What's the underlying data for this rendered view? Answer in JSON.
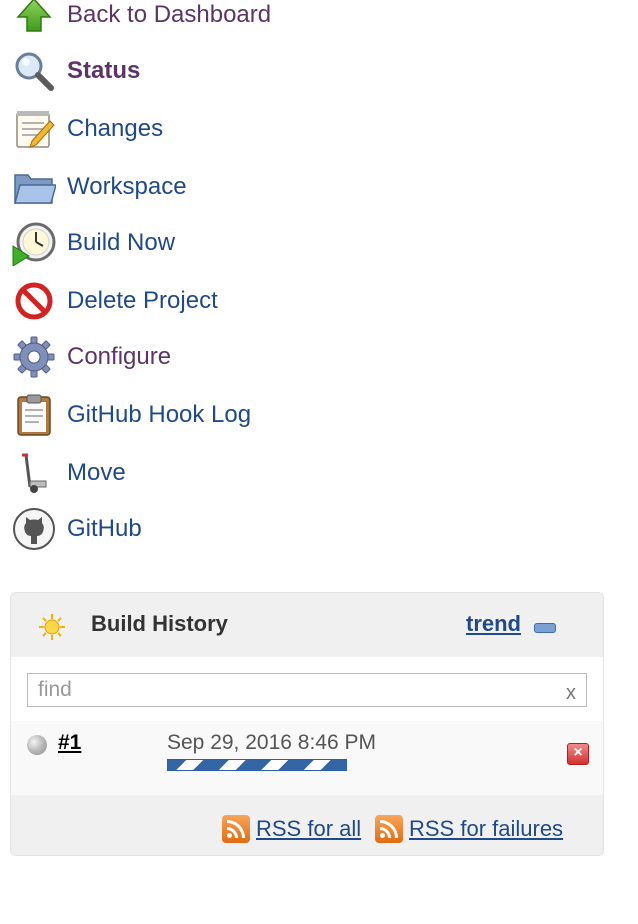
{
  "tasks": [
    {
      "label": "Back to Dashboard",
      "icon": "up-arrow-icon",
      "visited": true
    },
    {
      "label": "Status",
      "icon": "search-magnifier-icon",
      "visited": true,
      "bold": true
    },
    {
      "label": "Changes",
      "icon": "notepad-pencil-icon"
    },
    {
      "label": "Workspace",
      "icon": "folder-icon"
    },
    {
      "label": "Build Now",
      "icon": "clock-play-icon"
    },
    {
      "label": "Delete Project",
      "icon": "no-entry-icon"
    },
    {
      "label": "Configure",
      "icon": "gear-icon",
      "visited": true
    },
    {
      "label": "GitHub Hook Log",
      "icon": "clipboard-icon"
    },
    {
      "label": "Move",
      "icon": "hand-truck-icon"
    },
    {
      "label": "GitHub",
      "icon": "github-octocat-icon"
    }
  ],
  "build_history": {
    "title": "Build History",
    "trend_label": "trend",
    "search": {
      "placeholder": "find",
      "value": "",
      "clear_label": "x"
    },
    "builds": [
      {
        "number": "#1",
        "date": "Sep 29, 2016 8:46 PM",
        "status": "in-progress",
        "progress": 1.0
      }
    ],
    "rss_all": "RSS for all",
    "rss_failures": "RSS for failures"
  },
  "colors": {
    "link": "#204a87",
    "visited": "#5c3566",
    "panel_bg": "#f0f0f0",
    "progress": "#3465a4",
    "rss": "#e06c12"
  }
}
